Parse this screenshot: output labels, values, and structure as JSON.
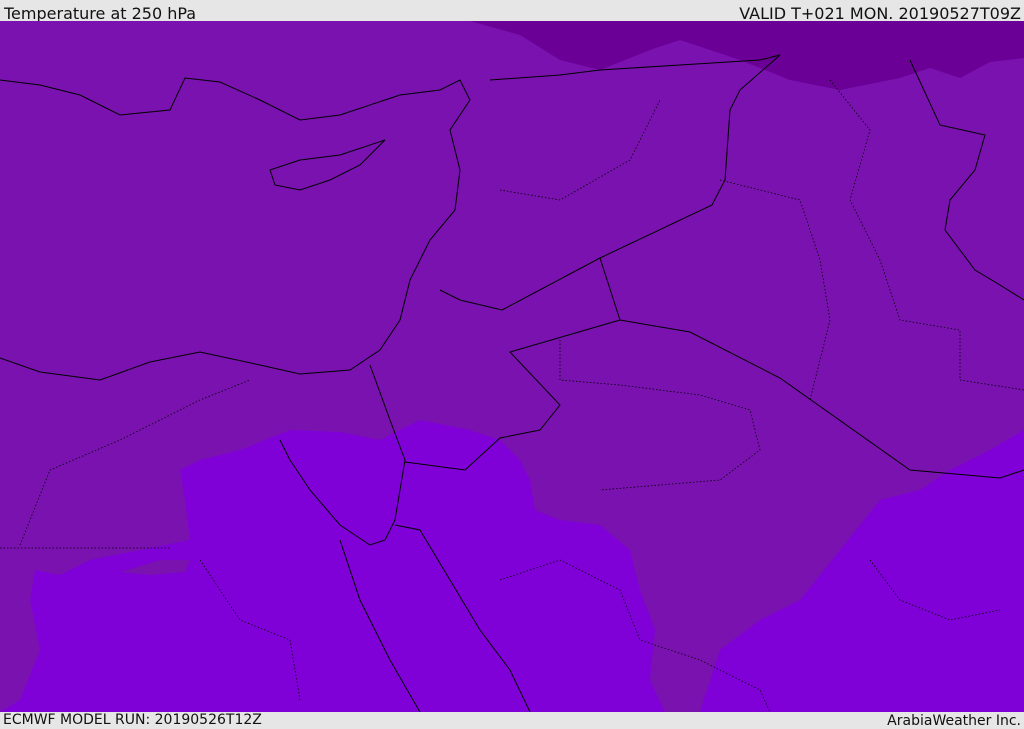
{
  "header": {
    "title": "Temperature at 250 hPa",
    "valid": "VALID T+021 MON. 20190527T09Z"
  },
  "footer": {
    "model_run": "ECMWF MODEL RUN: 20190526T12Z",
    "credit": "ArabiaWeather Inc."
  },
  "colors": {
    "mid": "#7a12b0",
    "warm": "#8000d8",
    "cold": "#6a0096",
    "background": "#e6e6e6"
  }
}
